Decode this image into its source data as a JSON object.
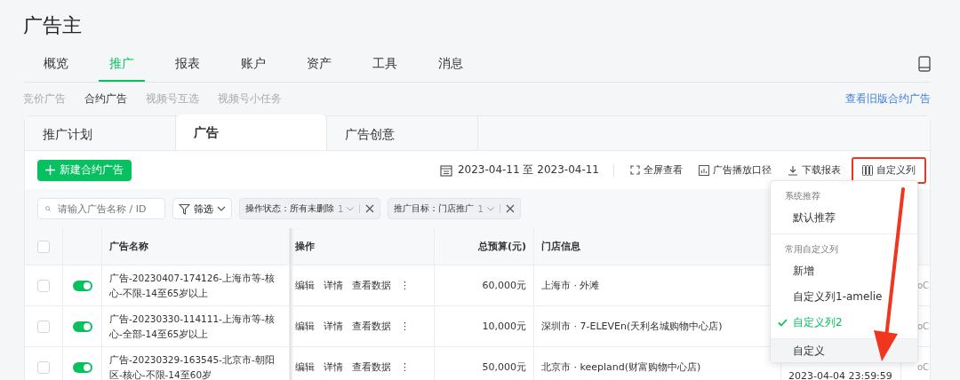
{
  "page_title": "广告主",
  "nav": [
    {
      "label": "概览",
      "selected": false
    },
    {
      "label": "推广",
      "selected": true
    },
    {
      "label": "报表",
      "selected": false
    },
    {
      "label": "账户",
      "selected": false
    },
    {
      "label": "资产",
      "selected": false
    },
    {
      "label": "工具",
      "selected": false
    },
    {
      "label": "消息",
      "selected": false
    }
  ],
  "subnav": [
    {
      "label": "竞价广告",
      "selected": false
    },
    {
      "label": "合约广告",
      "selected": true
    },
    {
      "label": "视频号互选",
      "selected": false
    },
    {
      "label": "视频号小任务",
      "selected": false
    }
  ],
  "old_version_link": "查看旧版合约广告",
  "tabs": [
    {
      "label": "推广计划",
      "selected": false
    },
    {
      "label": "广告",
      "selected": true
    },
    {
      "label": "广告创意",
      "selected": false
    }
  ],
  "toolbar": {
    "new_button": "新建合约广告",
    "date_range": "2023-04-11 至 2023-04-11",
    "actions": [
      {
        "kind": "fullscreen",
        "label": "全屏查看"
      },
      {
        "kind": "chart",
        "label": "广告播放口径"
      },
      {
        "kind": "download",
        "label": "下载报表"
      },
      {
        "kind": "columns",
        "label": "自定义列"
      }
    ]
  },
  "filters": {
    "search_placeholder": "请输入广告名称 / ID",
    "filter_button": "筛选",
    "chips": [
      {
        "text": "操作状态：所有未删除",
        "count": "1"
      },
      {
        "text": "推广目标：门店推广",
        "count": "1"
      }
    ]
  },
  "table": {
    "select_all_checked": false,
    "columns": [
      "广告名称",
      "操作",
      "总预算(元)",
      "门店信息"
    ],
    "rows": [
      {
        "checked": false,
        "on": true,
        "name": "广告-20230407-174126-上海市等-核心-不限-14至65岁以上",
        "actions": [
          "编辑",
          "详情",
          "查看数据",
          "⋮"
        ],
        "budget": "60,000元",
        "store": "上海市 · 外滩",
        "column_8": "oC"
      },
      {
        "checked": false,
        "on": true,
        "name": "广告-20230330-114111-上海市等-核心-全部-14至65岁以上",
        "actions": [
          "编辑",
          "详情",
          "查看数据",
          "⋮"
        ],
        "budget": "10,000元",
        "store": "深圳市 · 7-ELEVEn(天利名城购物中心店)",
        "column_8": "oC"
      },
      {
        "checked": false,
        "on": true,
        "name": "广告-20230329-163545-北京市-朝阳区-核心-不限-14至60岁",
        "actions": [
          "编辑",
          "详情",
          "查看数据",
          "⋮"
        ],
        "budget": "50,000元",
        "store": "北京市 · keepland(财富购物中心店)",
        "column_7": "2023-04-04 23:59:59",
        "column_8": "oC"
      }
    ]
  },
  "column_menu": {
    "groups": [
      {
        "title": "系统推荐",
        "items": [
          {
            "label": "默认推荐",
            "selected": false,
            "hovered": false
          }
        ]
      },
      {
        "title": "常用自定义列",
        "items": [
          {
            "label": "新增",
            "selected": false,
            "hovered": false
          },
          {
            "label": "自定义列1-amelie",
            "selected": false,
            "hovered": false
          },
          {
            "label": "自定义列2",
            "selected": true,
            "hovered": false
          }
        ]
      },
      {
        "items": [
          {
            "label": "自定义",
            "selected": false,
            "hovered": true
          }
        ]
      }
    ]
  }
}
